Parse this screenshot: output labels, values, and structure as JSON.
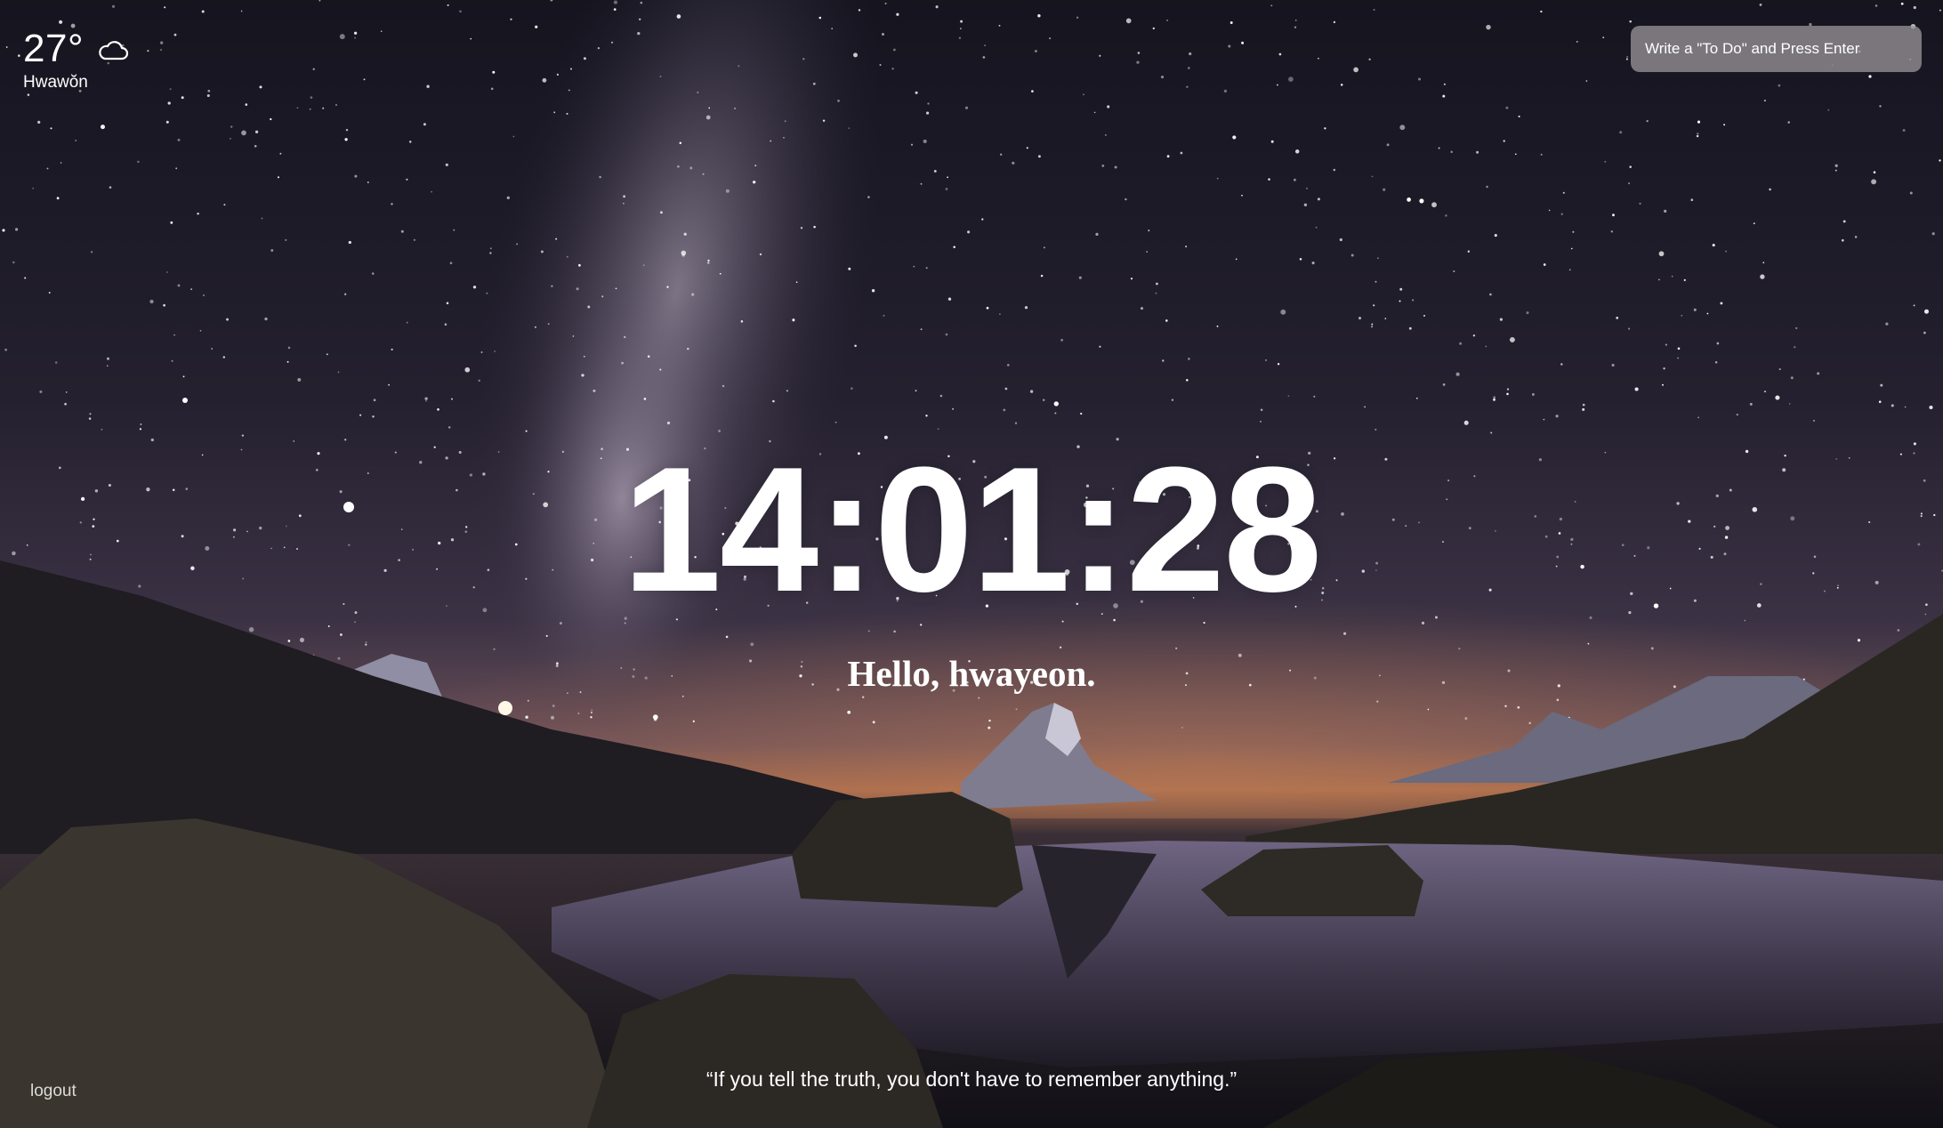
{
  "weather": {
    "temperature": "27°",
    "city": "Hwawŏn",
    "icon": "cloud-icon"
  },
  "todo": {
    "placeholder": "Write a \"To Do\" and Press Enter",
    "value": ""
  },
  "clock": {
    "time": "14:01:28"
  },
  "greeting": {
    "text": "Hello, hwayeon."
  },
  "quote": {
    "text": "“If you tell the truth, you don't have to remember anything.”"
  },
  "footer": {
    "logout_label": "logout"
  },
  "background": {
    "scene": "night sky with milky way over a mountain lake",
    "sky_color": "#1b1828",
    "horizon_glow": "#a86b4c"
  }
}
